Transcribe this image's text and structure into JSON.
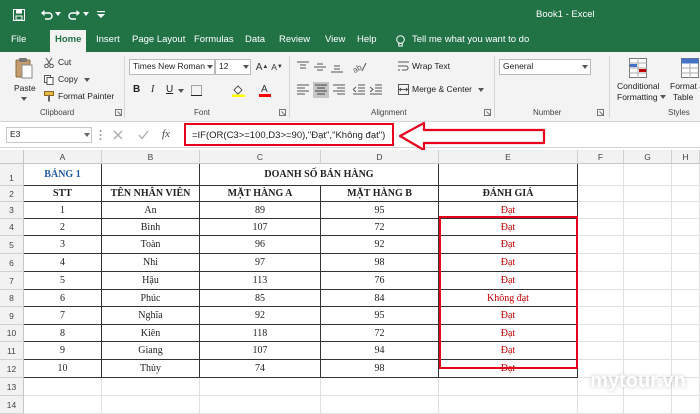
{
  "window": {
    "filename": "Book1",
    "app": "Excel"
  },
  "tabs": [
    "File",
    "Home",
    "Insert",
    "Page Layout",
    "Formulas",
    "Data",
    "Review",
    "View",
    "Help"
  ],
  "tell_me": "Tell me what you want to do",
  "ribbon": {
    "clipboard": {
      "paste": "Paste",
      "cut": "Cut",
      "copy": "Copy",
      "format_painter": "Format Painter",
      "label": "Clipboard"
    },
    "font": {
      "name": "Times New Roman",
      "size": "12",
      "bold": "B",
      "italic": "I",
      "underline": "U",
      "label": "Font"
    },
    "alignment": {
      "wrap_text": "Wrap Text",
      "merge_center": "Merge & Center",
      "label": "Alignment"
    },
    "number": {
      "format": "General",
      "label": "Number"
    },
    "styles": {
      "conditional": "Conditional",
      "formatting": "Formatting",
      "format_as": "Format as",
      "table": "Table",
      "label": "Styles"
    }
  },
  "formula_bar": {
    "name_box": "E3",
    "fx": "fx",
    "formula": "=IF(OR(C3>=100,D3>=90),\"Đạt\",\"Không đạt\")"
  },
  "columns": [
    "A",
    "B",
    "C",
    "D",
    "E",
    "F",
    "G",
    "H"
  ],
  "rows": [
    "1",
    "2",
    "3",
    "4",
    "5",
    "6",
    "7",
    "8",
    "9",
    "10",
    "11",
    "12",
    "13",
    "14"
  ],
  "sheet": {
    "title_a1": "BẢNG 1",
    "title_c1": "DOANH SỐ BÁN HÀNG",
    "headers": [
      "STT",
      "TÊN NHÂN VIÊN",
      "MẶT HÀNG A",
      "MẶT HÀNG B",
      "ĐÁNH GIÁ"
    ],
    "data": [
      [
        "1",
        "An",
        "89",
        "95",
        "Đạt"
      ],
      [
        "2",
        "Bình",
        "107",
        "72",
        "Đạt"
      ],
      [
        "3",
        "Toàn",
        "96",
        "92",
        "Đạt"
      ],
      [
        "4",
        "Nhi",
        "97",
        "98",
        "Đạt"
      ],
      [
        "5",
        "Hậu",
        "113",
        "76",
        "Đạt"
      ],
      [
        "6",
        "Phúc",
        "85",
        "84",
        "Không đạt"
      ],
      [
        "7",
        "Nghĩa",
        "92",
        "95",
        "Đạt"
      ],
      [
        "8",
        "Kiên",
        "118",
        "72",
        "Đạt"
      ],
      [
        "9",
        "Giang",
        "107",
        "94",
        "Đạt"
      ],
      [
        "10",
        "Thủy",
        "74",
        "98",
        "Đạt"
      ]
    ]
  },
  "watermark": "mytour.vn",
  "colors": {
    "excel_green": "#217346",
    "highlight_red": "#e8001c",
    "result_red": "#c00000",
    "title_blue": "#1f5aa8"
  }
}
